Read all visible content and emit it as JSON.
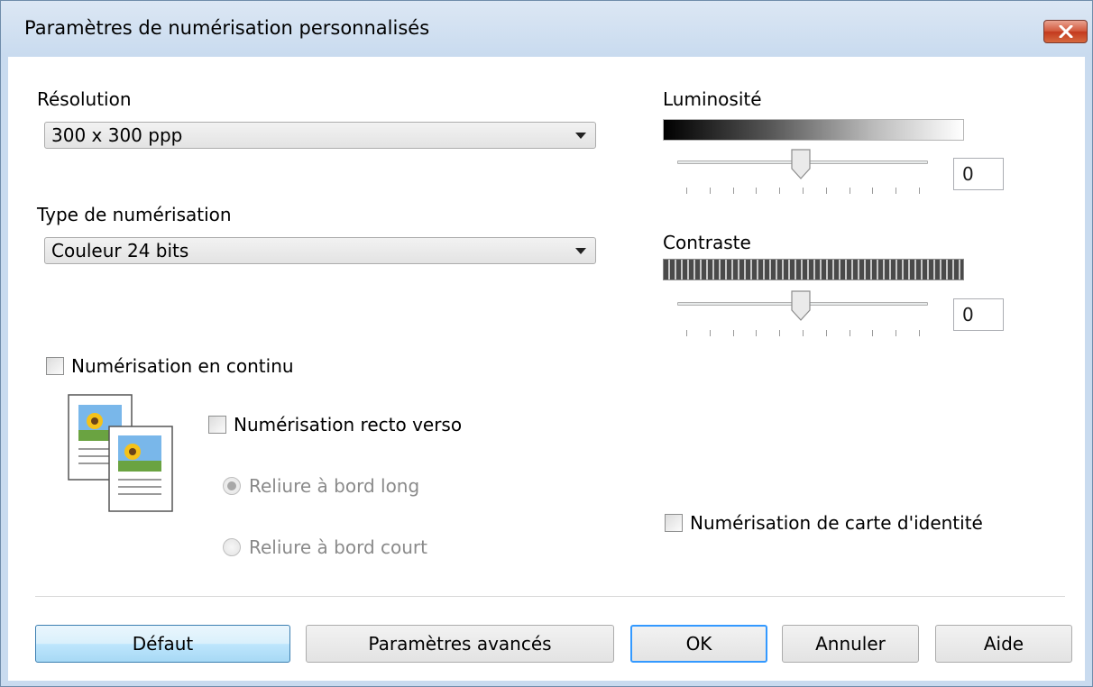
{
  "window": {
    "title": "Paramètres de numérisation personnalisés",
    "close_icon": "close-icon"
  },
  "resolution": {
    "label": "Résolution",
    "value": "300 x 300 ppp"
  },
  "scan_type": {
    "label": "Type de numérisation",
    "value": "Couleur 24 bits"
  },
  "brightness": {
    "label": "Luminosité",
    "value": "0",
    "slider_level": 0.5
  },
  "contrast": {
    "label": "Contraste",
    "value": "0",
    "slider_level": 0.5
  },
  "continuous_scan": {
    "label": "Numérisation en continu",
    "checked": false
  },
  "duplex": {
    "label": "Numérisation recto verso",
    "checked": false,
    "long_edge": {
      "label": "Reliure à bord long",
      "selected": true,
      "enabled": false
    },
    "short_edge": {
      "label": "Reliure à bord court",
      "selected": false,
      "enabled": false
    }
  },
  "id_card": {
    "label": "Numérisation de carte d'identité",
    "checked": false
  },
  "buttons": {
    "default": "Défaut",
    "advanced": "Paramètres avancés",
    "ok": "OK",
    "cancel": "Annuler",
    "help": "Aide"
  },
  "colors": {
    "accent": "#3399ff",
    "close": "#c3391e"
  }
}
